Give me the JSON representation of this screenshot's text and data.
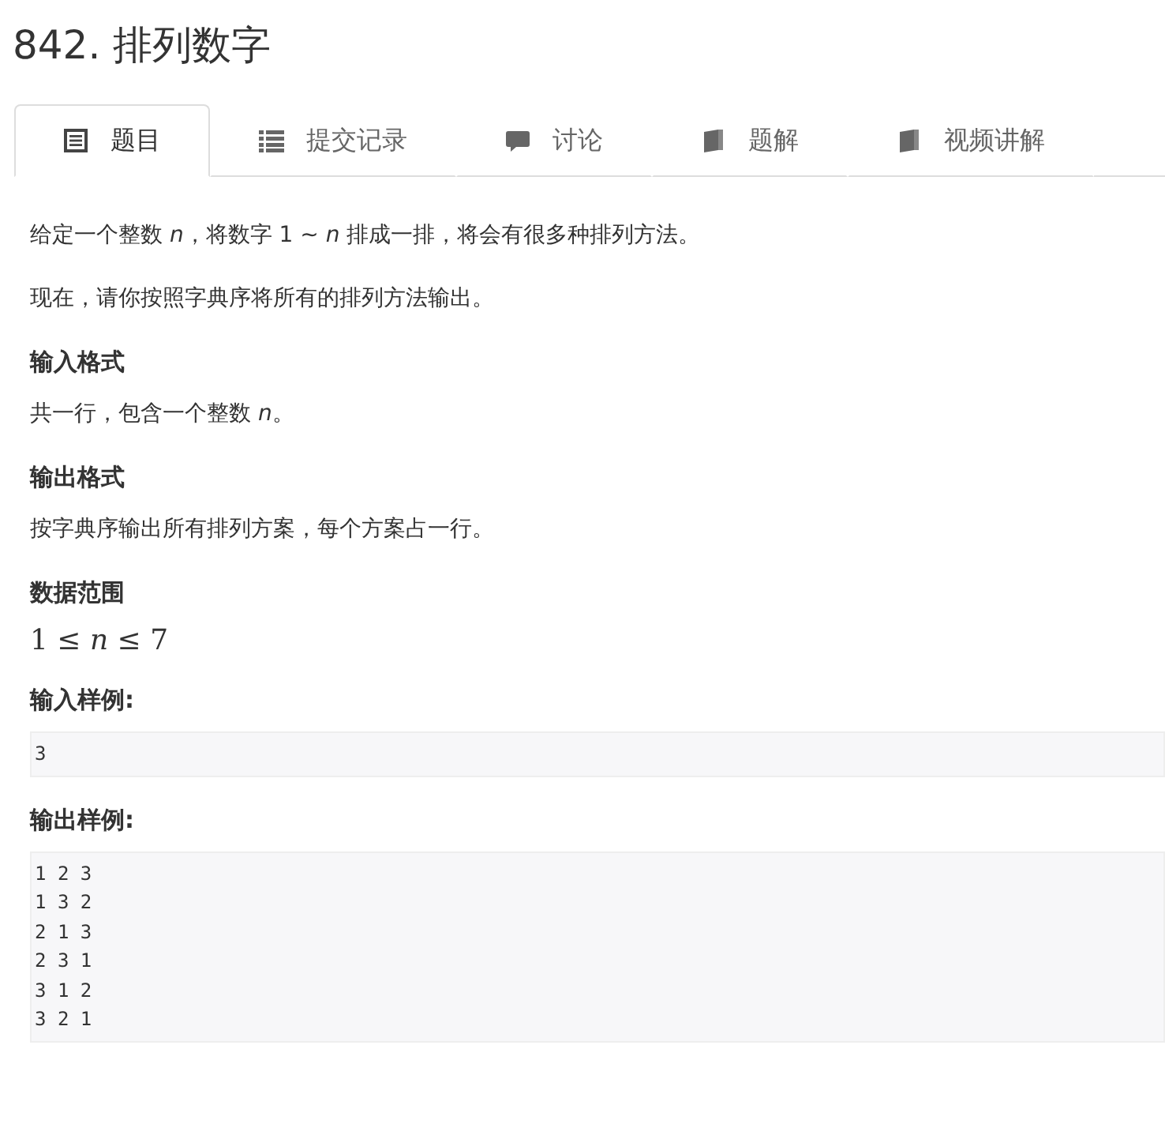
{
  "title": "842. 排列数字",
  "tabs": [
    {
      "label": "题目",
      "kind": "doc",
      "selected": true
    },
    {
      "label": "提交记录",
      "kind": "list",
      "selected": false
    },
    {
      "label": "讨论",
      "kind": "comment",
      "selected": false
    },
    {
      "label": "题解",
      "kind": "book",
      "selected": false
    },
    {
      "label": "视频讲解",
      "kind": "book",
      "selected": false
    }
  ],
  "blocks": [
    {
      "kind": "text",
      "text": "给定一个整数 *n*，将数字 1 ∼ *n* 排成一排，将会有很多种排列方法。"
    },
    {
      "kind": "text",
      "text": "现在，请你按照字典序将所有的排列方法输出。"
    },
    {
      "kind": "heading",
      "text": "输入格式"
    },
    {
      "kind": "text",
      "text": "共一行，包含一个整数 *n*。"
    },
    {
      "kind": "heading",
      "text": "输出格式"
    },
    {
      "kind": "text",
      "text": "按字典序输出所有排列方案，每个方案占一行。"
    },
    {
      "kind": "heading",
      "text": "数据范围"
    },
    {
      "kind": "math",
      "text": "1 ≤ *n* ≤ 7"
    },
    {
      "kind": "heading",
      "text": "输入样例:"
    },
    {
      "kind": "code",
      "lines": [
        "3"
      ]
    },
    {
      "kind": "heading",
      "text": "输出样例:"
    },
    {
      "kind": "code",
      "lines": [
        "1 2 3",
        "1 3 2",
        "2 1 3",
        "2 3 1",
        "3 1 2",
        "3 2 1"
      ]
    }
  ]
}
